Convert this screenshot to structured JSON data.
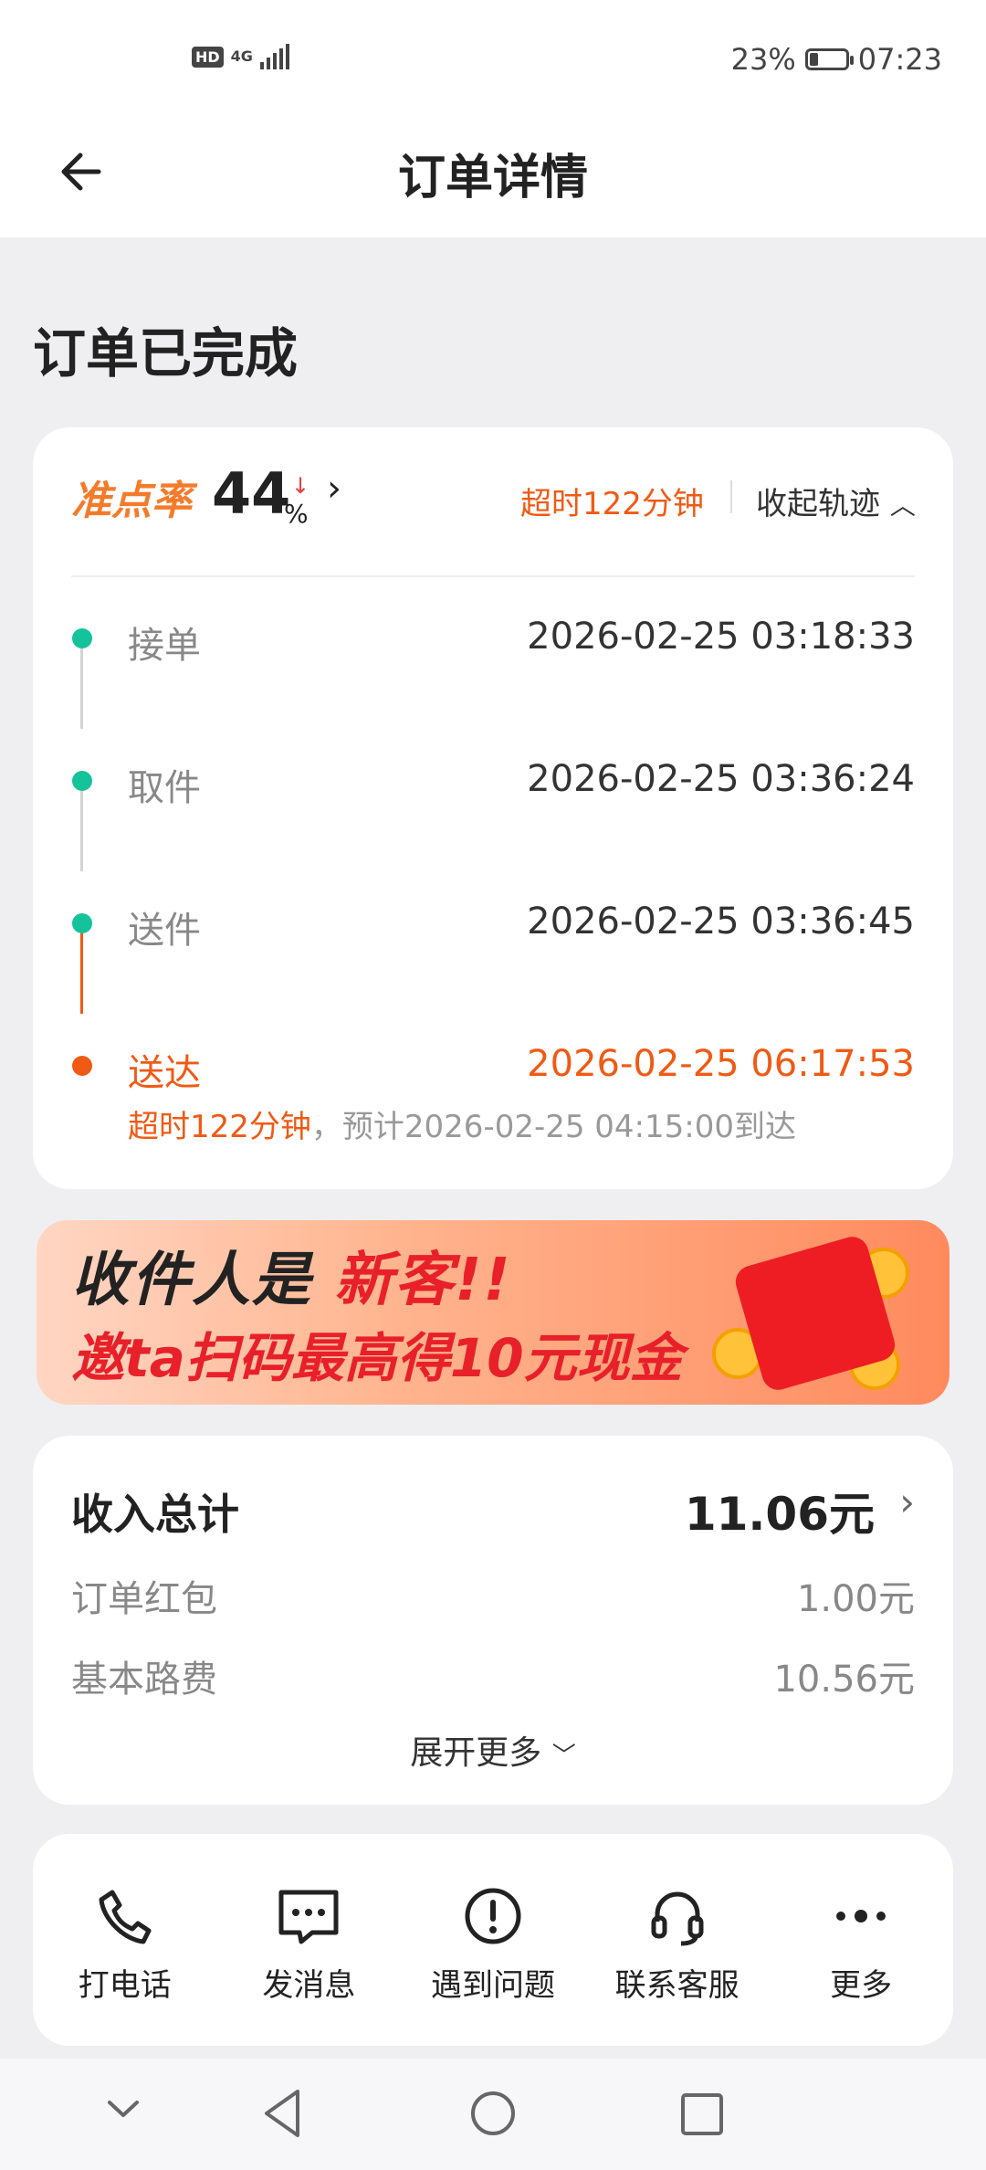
{
  "status_bar": {
    "hd": "HD",
    "network": "4G",
    "battery_percent": "23%",
    "time": "07:23"
  },
  "header": {
    "title": "订单详情"
  },
  "order_status": "订单已完成",
  "ontime": {
    "label": "准点率",
    "value": "44",
    "unit": "%",
    "overdue": "超时122分钟",
    "collapse": "收起轨迹"
  },
  "timeline": [
    {
      "label": "接单",
      "time": "2026-02-25 03:18:33"
    },
    {
      "label": "取件",
      "time": "2026-02-25 03:36:24"
    },
    {
      "label": "送件",
      "time": "2026-02-25 03:36:45"
    },
    {
      "label": "送达",
      "time": "2026-02-25 06:17:53"
    }
  ],
  "delivery_note": {
    "overdue": "超时122分钟",
    "expected": "，预计2026-02-25 04:15:00到达"
  },
  "banner": {
    "line1_prefix": "收件人是",
    "line1_highlight": "新客!!",
    "line2": "邀ta扫码最高得10元现金"
  },
  "income": {
    "title": "收入总计",
    "total": "11.06元",
    "items": [
      {
        "label": "订单红包",
        "value": "1.00元"
      },
      {
        "label": "基本路费",
        "value": "10.56元"
      }
    ],
    "expand": "展开更多"
  },
  "actions": [
    {
      "label": "打电话",
      "icon": "phone-icon"
    },
    {
      "label": "发消息",
      "icon": "message-icon"
    },
    {
      "label": "遇到问题",
      "icon": "alert-icon"
    },
    {
      "label": "联系客服",
      "icon": "headset-icon"
    },
    {
      "label": "更多",
      "icon": "more-icon"
    }
  ],
  "colors": {
    "accent_orange": "#f05a14",
    "timeline_green": "#15c39a",
    "ontime_label": "#f47b2a"
  }
}
